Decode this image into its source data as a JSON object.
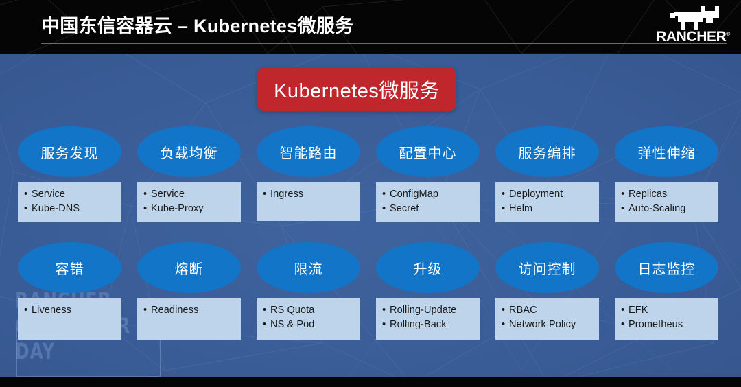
{
  "header": {
    "title": "中国东信容器云 – Kubernetes微服务",
    "logo": {
      "wordmark": "RANCHER",
      "trademark": "®",
      "mark_icon": "bull-icon"
    }
  },
  "watermark": {
    "line1": "RANCHER",
    "line2": "CONTAINER",
    "line3": "DAY"
  },
  "title_pill": {
    "label": "Kubernetes微服务",
    "color": "#c0272d"
  },
  "colors": {
    "background": "#3a5c96",
    "ellipse": "#1275c8",
    "item_box": "#bdd4ea",
    "accent_red": "#c0272d",
    "header_black": "#050505",
    "text_light": "#ffffff",
    "text_dark": "#1a1a1a"
  },
  "rows": [
    {
      "cells": [
        {
          "title": "服务发现",
          "items": [
            "Service",
            "Kube-DNS"
          ]
        },
        {
          "title": "负载均衡",
          "items": [
            "Service",
            "Kube-Proxy"
          ]
        },
        {
          "title": "智能路由",
          "items": [
            "Ingress"
          ]
        },
        {
          "title": "配置中心",
          "items": [
            "ConfigMap",
            "Secret"
          ]
        },
        {
          "title": "服务编排",
          "items": [
            "Deployment",
            "Helm"
          ]
        },
        {
          "title": "弹性伸缩",
          "items": [
            "Replicas",
            "Auto-Scaling"
          ]
        }
      ]
    },
    {
      "cells": [
        {
          "title": "容错",
          "items": [
            "Liveness"
          ]
        },
        {
          "title": "熔断",
          "items": [
            "Readiness"
          ]
        },
        {
          "title": "限流",
          "items": [
            "RS Quota",
            "NS & Pod"
          ]
        },
        {
          "title": "升级",
          "items": [
            "Rolling-Update",
            "Rolling-Back"
          ]
        },
        {
          "title": "访问控制",
          "items": [
            "RBAC",
            "Network Policy"
          ]
        },
        {
          "title": "日志监控",
          "items": [
            "EFK",
            "Prometheus"
          ]
        }
      ]
    }
  ]
}
